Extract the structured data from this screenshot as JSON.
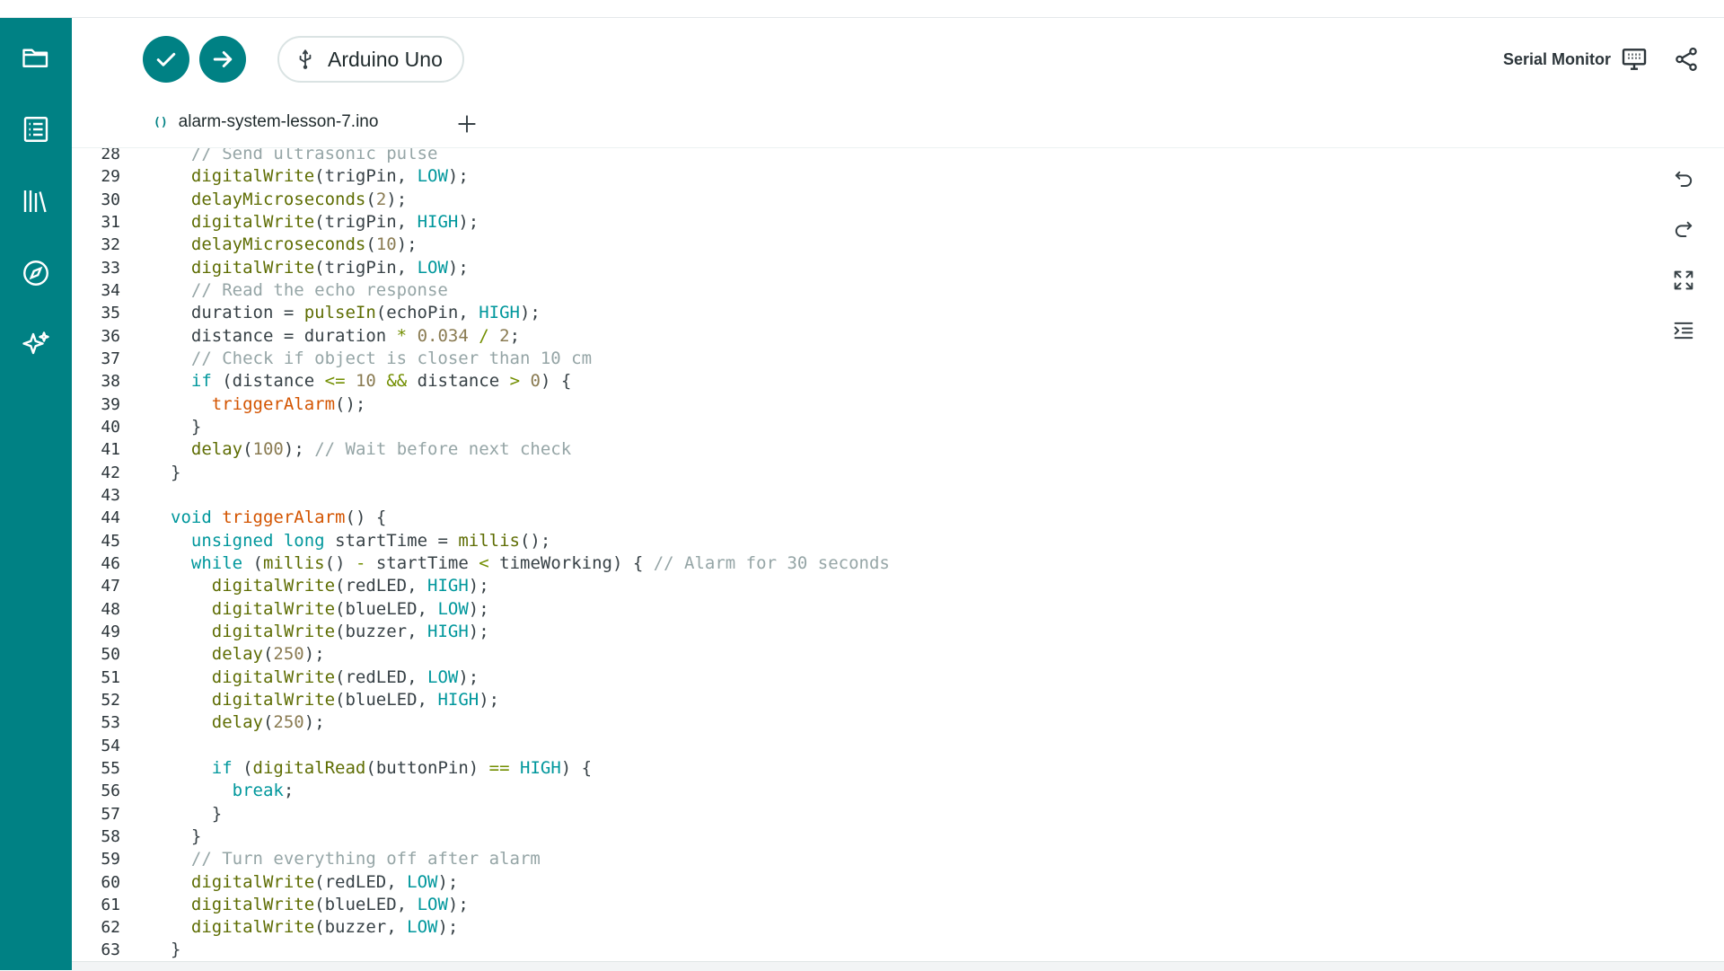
{
  "sidebar": {
    "items": [
      {
        "icon": "folder-icon",
        "name": "sketchbook"
      },
      {
        "icon": "examples-icon",
        "name": "examples"
      },
      {
        "icon": "library-icon",
        "name": "libraries"
      },
      {
        "icon": "compass-icon",
        "name": "reference"
      },
      {
        "icon": "sparkle-icon",
        "name": "ai-assistant"
      }
    ]
  },
  "toolbar": {
    "verify_icon": "check-icon",
    "upload_icon": "arrow-right-icon",
    "board_label": "Arduino Uno",
    "board_icon": "usb-icon",
    "serial_monitor_label": "Serial Monitor",
    "serial_monitor_icon": "monitor-icon",
    "share_icon": "share-icon"
  },
  "tabs": [
    {
      "label": "alarm-system-lesson-7.ino",
      "icon": "code-icon"
    }
  ],
  "add_tab_icon": "plus-icon",
  "colors": {
    "accent": "#008184",
    "keyword": "#00979c",
    "function": "#5e6d03",
    "comment": "#95a5a6",
    "user_function": "#d35400"
  },
  "editor": {
    "lines": [
      {
        "n": "28",
        "code": "  // Send ultrasonic pulse"
      },
      {
        "n": "29",
        "code": "  digitalWrite(trigPin, LOW);"
      },
      {
        "n": "30",
        "code": "  delayMicroseconds(2);"
      },
      {
        "n": "31",
        "code": "  digitalWrite(trigPin, HIGH);"
      },
      {
        "n": "32",
        "code": "  delayMicroseconds(10);"
      },
      {
        "n": "33",
        "code": "  digitalWrite(trigPin, LOW);"
      },
      {
        "n": "34",
        "code": "  // Read the echo response"
      },
      {
        "n": "35",
        "code": "  duration = pulseIn(echoPin, HIGH);"
      },
      {
        "n": "36",
        "code": "  distance = duration * 0.034 / 2;"
      },
      {
        "n": "37",
        "code": "  // Check if object is closer than 10 cm"
      },
      {
        "n": "38",
        "code": "  if (distance <= 10 && distance > 0) {"
      },
      {
        "n": "39",
        "code": "    triggerAlarm();"
      },
      {
        "n": "40",
        "code": "  }"
      },
      {
        "n": "41",
        "code": "  delay(100); // Wait before next check"
      },
      {
        "n": "42",
        "code": "}"
      },
      {
        "n": "43",
        "code": ""
      },
      {
        "n": "44",
        "code": "void triggerAlarm() {"
      },
      {
        "n": "45",
        "code": "  unsigned long startTime = millis();"
      },
      {
        "n": "46",
        "code": "  while (millis() - startTime < timeWorking) { // Alarm for 30 seconds"
      },
      {
        "n": "47",
        "code": "    digitalWrite(redLED, HIGH);"
      },
      {
        "n": "48",
        "code": "    digitalWrite(blueLED, LOW);"
      },
      {
        "n": "49",
        "code": "    digitalWrite(buzzer, HIGH);"
      },
      {
        "n": "50",
        "code": "    delay(250);"
      },
      {
        "n": "51",
        "code": "    digitalWrite(redLED, LOW);"
      },
      {
        "n": "52",
        "code": "    digitalWrite(blueLED, HIGH);"
      },
      {
        "n": "53",
        "code": "    delay(250);"
      },
      {
        "n": "54",
        "code": ""
      },
      {
        "n": "55",
        "code": "    if (digitalRead(buttonPin) == HIGH) {"
      },
      {
        "n": "56",
        "code": "      break;"
      },
      {
        "n": "57",
        "code": "    }"
      },
      {
        "n": "58",
        "code": "  }"
      },
      {
        "n": "59",
        "code": "  // Turn everything off after alarm"
      },
      {
        "n": "60",
        "code": "  digitalWrite(redLED, LOW);"
      },
      {
        "n": "61",
        "code": "  digitalWrite(blueLED, LOW);"
      },
      {
        "n": "62",
        "code": "  digitalWrite(buzzer, LOW);"
      },
      {
        "n": "63",
        "code": "}"
      }
    ]
  },
  "right_tools": [
    {
      "icon": "undo-icon"
    },
    {
      "icon": "redo-icon"
    },
    {
      "icon": "expand-icon"
    },
    {
      "icon": "indent-icon"
    }
  ]
}
